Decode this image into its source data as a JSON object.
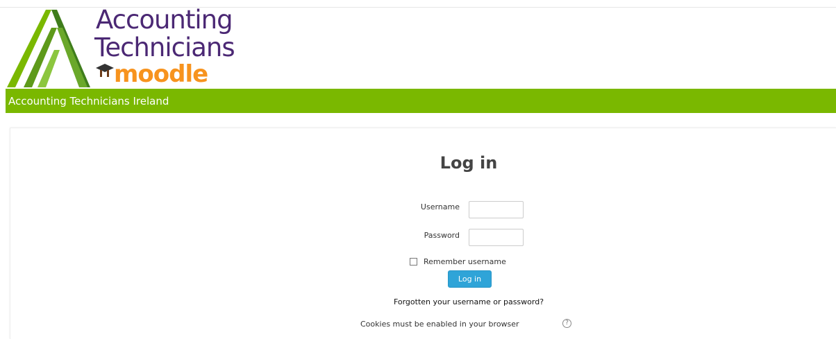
{
  "brand": {
    "logo_line1": "Accounting",
    "logo_line2": "Technicians",
    "logo_moodle": "moodle",
    "site_name": "Accounting Technicians Ireland",
    "colors": {
      "green_bar": "#7ab800",
      "logo_purple": "#4b2874",
      "moodle_orange": "#f7931e",
      "button_blue": "#2fa4d8"
    }
  },
  "login": {
    "title": "Log in",
    "username_label": "Username",
    "username_value": "",
    "password_label": "Password",
    "password_value": "",
    "remember_label": "Remember username",
    "remember_checked": false,
    "submit_label": "Log in",
    "forgot_link": "Forgotten your username or password?",
    "cookies_notice": "Cookies must be enabled in your browser",
    "help_icon": "question-mark-icon",
    "help_glyph": "?"
  }
}
